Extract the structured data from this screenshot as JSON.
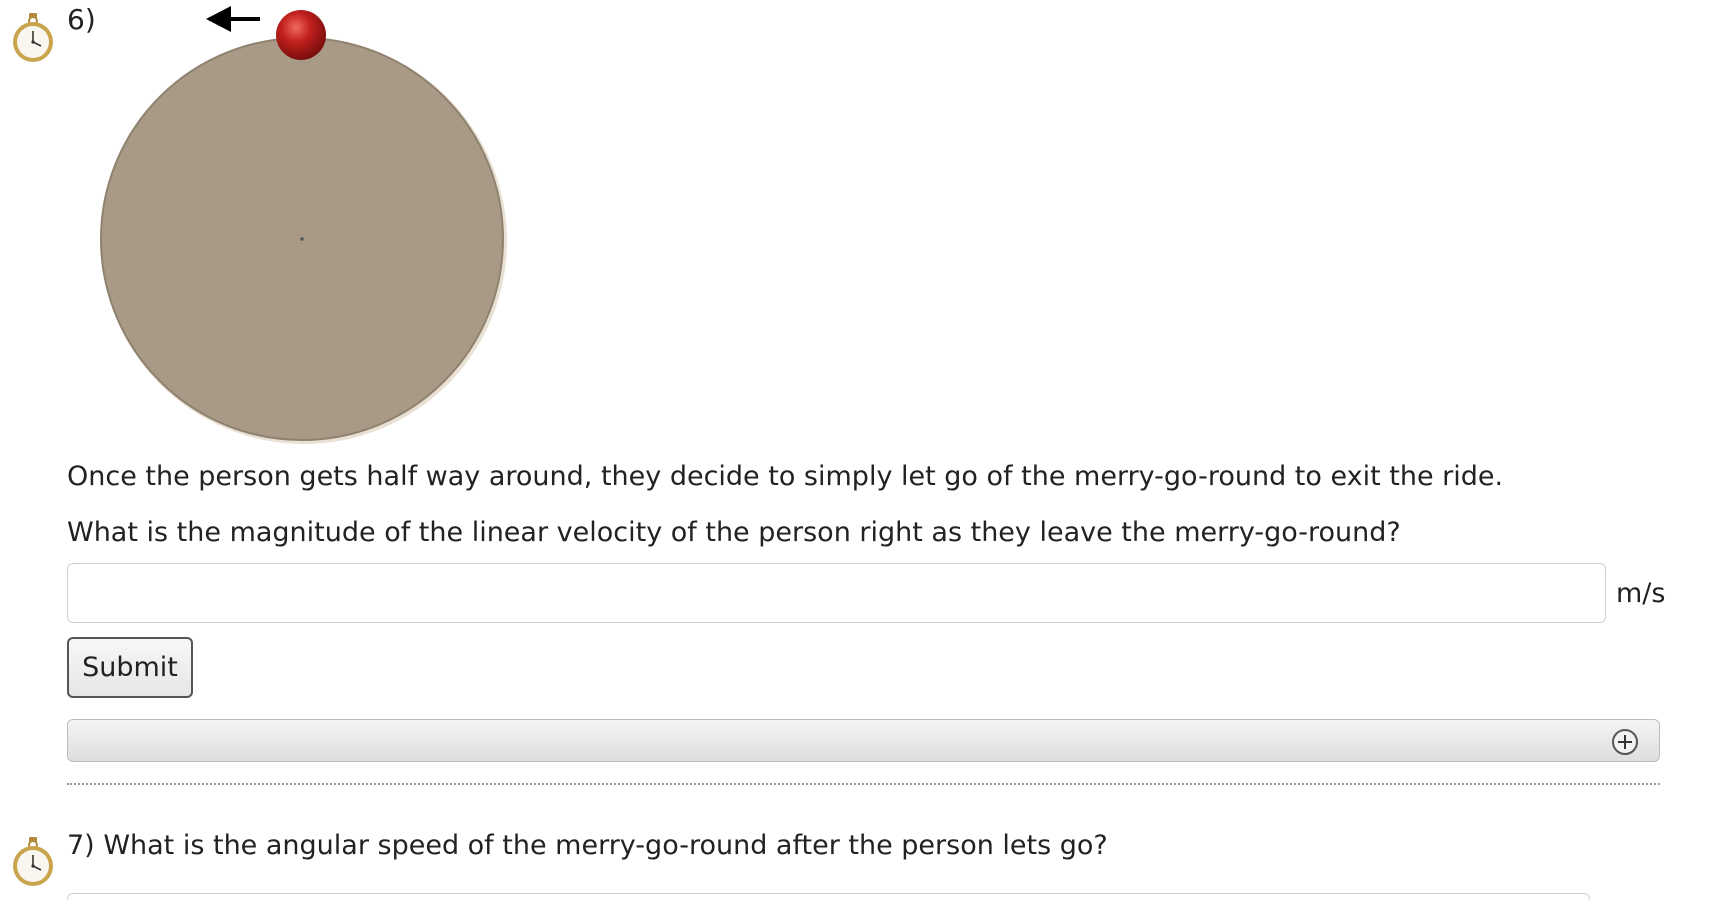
{
  "question6": {
    "number": "6)",
    "diagram_alt": "merry-go-round-diagram",
    "statement": "Once the person gets half way around, they decide to simply let go of the merry-go-round to exit the ride.",
    "prompt": "What is the magnitude of the linear velocity of the person right as they leave the merry-go-round?",
    "answer_value": "",
    "answer_placeholder": "",
    "unit": "m/s",
    "submit_label": "Submit"
  },
  "question7": {
    "number": "7)",
    "prompt": "What is the angular speed of the merry-go-round after the person lets go?"
  },
  "icons": {
    "timer": "stopwatch-icon",
    "expand": "plus-circle-icon",
    "direction": "arrow-left-icon"
  },
  "colors": {
    "disk": "#a89a86",
    "ball": "#c0201e",
    "text": "#222222"
  }
}
